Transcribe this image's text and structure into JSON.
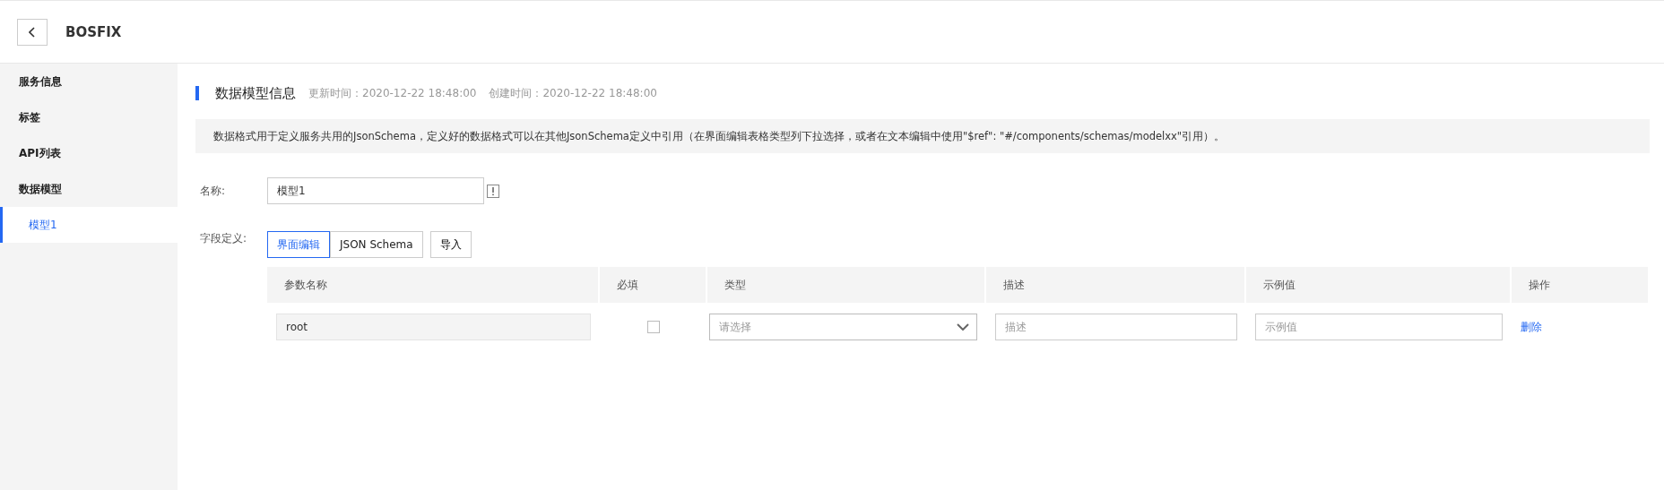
{
  "header": {
    "title": "BOSFIX"
  },
  "sidebar": {
    "items": [
      {
        "label": "服务信息",
        "selected": false
      },
      {
        "label": "标签",
        "selected": false
      },
      {
        "label": "API列表",
        "selected": false
      },
      {
        "label": "数据模型",
        "selected": false,
        "children": [
          {
            "label": "模型1",
            "selected": true
          }
        ]
      }
    ]
  },
  "section": {
    "title": "数据模型信息",
    "updated": "更新时间：2020-12-22 18:48:00",
    "created": "创建时间：2020-12-22 18:48:00"
  },
  "notice": "数据格式用于定义服务共用的JsonSchema，定义好的数据格式可以在其他JsonSchema定义中引用（在界面编辑表格类型列下拉选择，或者在文本编辑中使用\"$ref\": \"#/components/schemas/modelxx\"引用）。",
  "name_field": {
    "label": "名称:",
    "value": "模型1"
  },
  "fields": {
    "label": "字段定义:",
    "modes": [
      {
        "label": "界面编辑",
        "selected": true
      },
      {
        "label": "JSON Schema",
        "selected": false
      }
    ],
    "import_button": "导入"
  },
  "table": {
    "columns": [
      "参数名称",
      "必填",
      "类型",
      "描述",
      "示例值",
      "操作"
    ],
    "rows": [
      {
        "name": "root",
        "required": false,
        "type_placeholder": "请选择",
        "description_placeholder": "描述",
        "example_placeholder": "示例值",
        "action": "删除"
      }
    ]
  }
}
